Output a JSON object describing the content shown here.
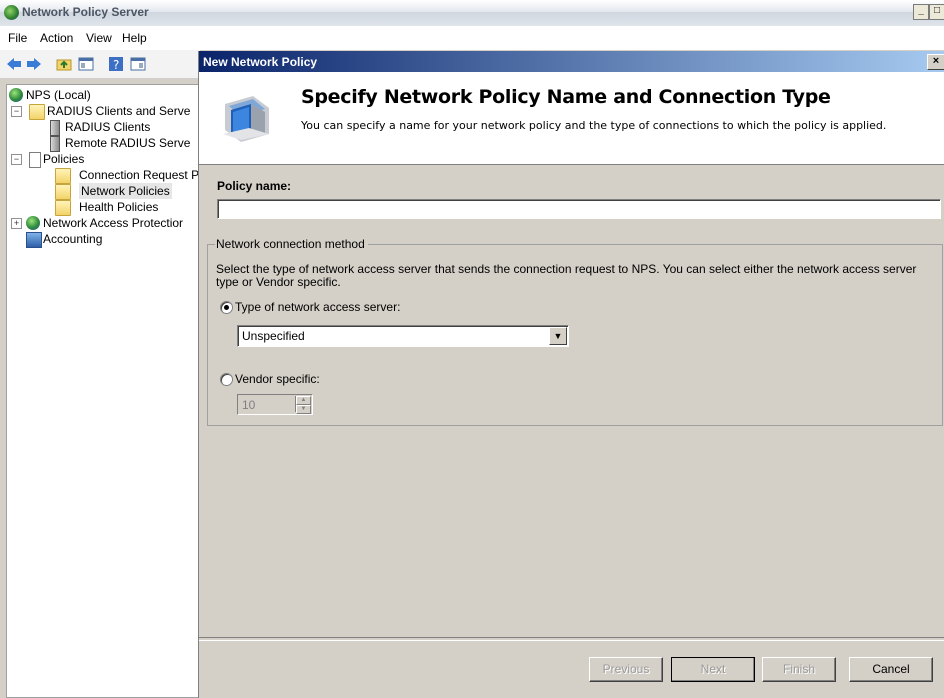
{
  "window": {
    "title": "Network Policy Server"
  },
  "menu": [
    "File",
    "Action",
    "View",
    "Help"
  ],
  "tree": {
    "nps_local": "NPS (Local)",
    "radius_clients_servers": "RADIUS Clients and Serve",
    "radius_clients": "RADIUS Clients",
    "remote_radius": "Remote RADIUS Serve",
    "policies": "Policies",
    "connection_request": "Connection Request P",
    "network_policies": "Network Policies",
    "health_policies": "Health Policies",
    "nap": "Network Access Protectior",
    "accounting": "Accounting"
  },
  "dialog": {
    "title": "New Network Policy",
    "header_title": "Specify Network Policy Name and Connection Type",
    "header_subtitle": "You can specify a name for your network policy and the type of connections to which the policy is applied.",
    "policy_name_label": "Policy name:",
    "policy_name_value": "",
    "group_legend": "Network connection method",
    "group_description": "Select the type of network access server that sends the connection request to NPS. You can select either the network access server type or Vendor specific.",
    "option_type_label": "Type of network access server:",
    "option_type_selected": true,
    "type_select_value": "Unspecified",
    "option_vendor_label": "Vendor specific:",
    "option_vendor_selected": false,
    "vendor_value": "10",
    "buttons": {
      "previous": "Previous",
      "next": "Next",
      "finish": "Finish",
      "cancel": "Cancel"
    }
  },
  "colors": {
    "dialog_titlebar": "#0a246a",
    "dialog_bg": "#d4d0c8"
  }
}
